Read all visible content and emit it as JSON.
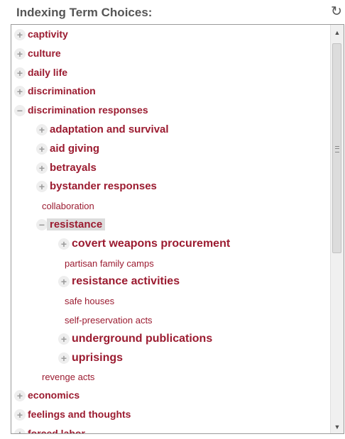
{
  "header": {
    "title": "Indexing Term Choices:",
    "refresh_icon": "refresh-icon"
  },
  "tree": {
    "expander_collapsed": "+",
    "expander_expanded": "−",
    "items": [
      {
        "label": "captivity",
        "level": 0,
        "state": "collapsed"
      },
      {
        "label": "culture",
        "level": 0,
        "state": "collapsed"
      },
      {
        "label": "daily life",
        "level": 0,
        "state": "collapsed"
      },
      {
        "label": "discrimination",
        "level": 0,
        "state": "collapsed"
      },
      {
        "label": "discrimination responses",
        "level": 0,
        "state": "expanded"
      },
      {
        "label": "adaptation and survival",
        "level": 1,
        "state": "collapsed"
      },
      {
        "label": "aid giving",
        "level": 1,
        "state": "collapsed"
      },
      {
        "label": "betrayals",
        "level": 1,
        "state": "collapsed"
      },
      {
        "label": "bystander responses",
        "level": 1,
        "state": "collapsed"
      },
      {
        "label": "collaboration",
        "level": 1,
        "state": "leaf"
      },
      {
        "label": "resistance",
        "level": 1,
        "state": "expanded",
        "selected": true
      },
      {
        "label": "covert weapons procurement",
        "level": 2,
        "state": "collapsed"
      },
      {
        "label": "partisan family camps",
        "level": 2,
        "state": "leaf"
      },
      {
        "label": "resistance activities",
        "level": 2,
        "state": "collapsed"
      },
      {
        "label": "safe houses",
        "level": 2,
        "state": "leaf"
      },
      {
        "label": "self-preservation acts",
        "level": 2,
        "state": "leaf"
      },
      {
        "label": "underground publications",
        "level": 2,
        "state": "collapsed"
      },
      {
        "label": "uprisings",
        "level": 2,
        "state": "collapsed"
      },
      {
        "label": "revenge acts",
        "level": 1,
        "state": "leaf"
      },
      {
        "label": "economics",
        "level": 0,
        "state": "collapsed"
      },
      {
        "label": "feelings and thoughts",
        "level": 0,
        "state": "collapsed"
      },
      {
        "label": "forced labor",
        "level": 0,
        "state": "collapsed"
      }
    ]
  },
  "scrollbar": {
    "up_icon": "▲",
    "down_icon": "▼",
    "position_fraction": 0.0,
    "visible_fraction": 0.55
  },
  "colors": {
    "term": "#9b1b30",
    "title": "#555555",
    "selected_bg": "#dcdcdc"
  }
}
